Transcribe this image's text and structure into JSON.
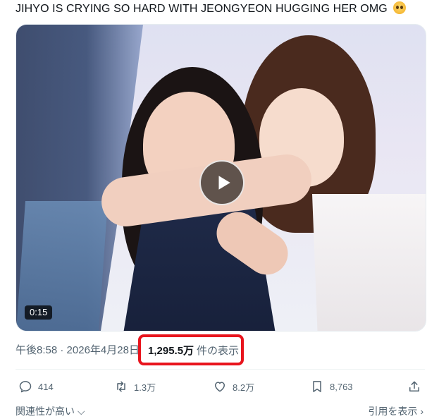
{
  "tweet": {
    "text": "JIHYO IS CRYING SO HARD WITH JEONGYEON HUGGING HER OMG"
  },
  "media": {
    "duration": "0:15"
  },
  "meta": {
    "time": "午後8:58",
    "separator": "·",
    "date": "2026年4月28日",
    "views_count": "1,295.5万",
    "views_label": "件の表示"
  },
  "actions": {
    "reply_count": "414",
    "retweet_count": "1.3万",
    "like_count": "8.2万",
    "bookmark_count": "8,763"
  },
  "footer": {
    "sort_label": "関連性が高い",
    "quotes_label": "引用を表示"
  },
  "colors": {
    "highlight_border": "#e8141d",
    "secondary_text": "#536471",
    "primary_text": "#0f1419"
  }
}
